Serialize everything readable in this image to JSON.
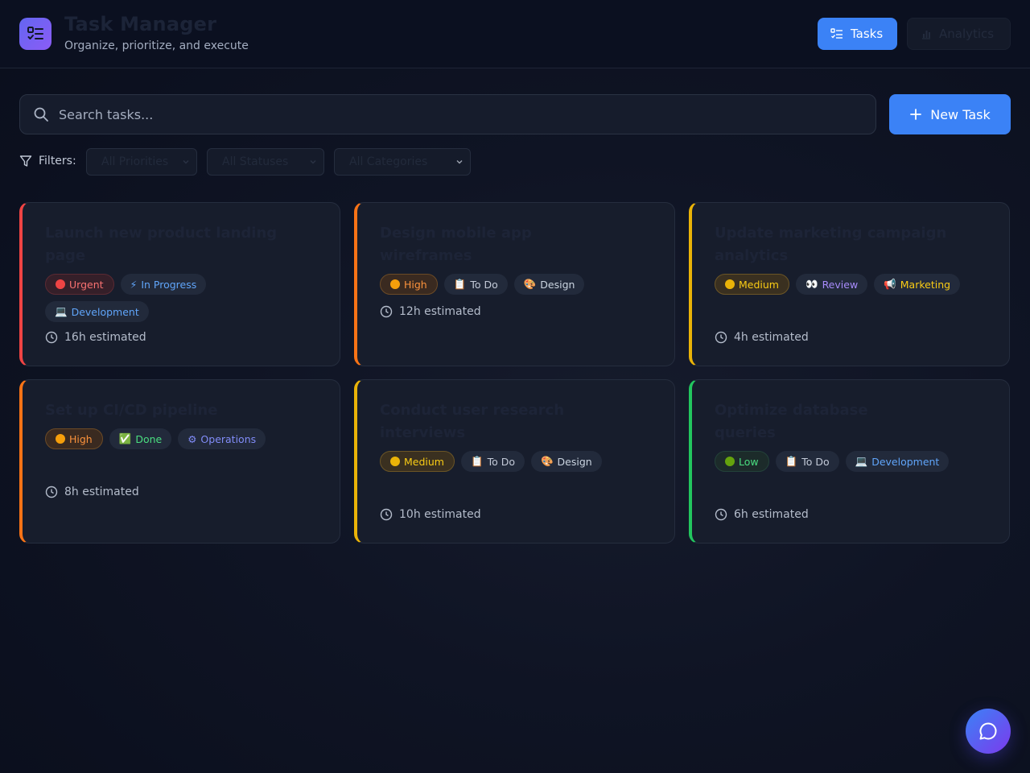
{
  "header": {
    "title": "Task Manager",
    "subtitle": "Organize, prioritize, and execute",
    "nav": {
      "tasks_label": "Tasks",
      "analytics_label": "Analytics"
    }
  },
  "search": {
    "placeholder": "Search tasks..."
  },
  "new_task_label": "New Task",
  "filters": {
    "label": "Filters:",
    "priority": "All Priorities",
    "status": "All Statuses",
    "category": "All Categories"
  },
  "colors": {
    "accent": "#3b82f6",
    "urgent": "#ef4444",
    "high": "#f97316",
    "medium": "#eab308",
    "low": "#22c55e"
  },
  "tasks": [
    {
      "title": "Launch new product landing page",
      "priority": {
        "label": "Urgent",
        "icon": "red-circle"
      },
      "status": {
        "label": "In Progress",
        "icon": "⚡"
      },
      "category": {
        "label": "Development",
        "icon": "💻"
      },
      "estimate": "16h estimated"
    },
    {
      "title": "Design mobile app wireframes",
      "priority": {
        "label": "High",
        "icon": "orange-circle"
      },
      "status": {
        "label": "To Do",
        "icon": "📋"
      },
      "category": {
        "label": "Design",
        "icon": "🎨"
      },
      "estimate": "12h estimated"
    },
    {
      "title": "Update marketing campaign analytics",
      "priority": {
        "label": "Medium",
        "icon": "yellow-circle"
      },
      "status": {
        "label": "Review",
        "icon": "👀"
      },
      "category": {
        "label": "Marketing",
        "icon": "📢"
      },
      "estimate": "4h estimated"
    },
    {
      "title": "Set up CI/CD pipeline",
      "priority": {
        "label": "High",
        "icon": "orange-circle"
      },
      "status": {
        "label": "Done",
        "icon": "✅"
      },
      "category": {
        "label": "Operations",
        "icon": "⚙"
      },
      "estimate": "8h estimated"
    },
    {
      "title": "Conduct user research interviews",
      "priority": {
        "label": "Medium",
        "icon": "yellow-circle"
      },
      "status": {
        "label": "To Do",
        "icon": "📋"
      },
      "category": {
        "label": "Design",
        "icon": "🎨"
      },
      "estimate": "10h estimated"
    },
    {
      "title": "Optimize database queries",
      "priority": {
        "label": "Low",
        "icon": "green-circle"
      },
      "status": {
        "label": "To Do",
        "icon": "📋"
      },
      "category": {
        "label": "Development",
        "icon": "💻"
      },
      "estimate": "6h estimated"
    }
  ]
}
